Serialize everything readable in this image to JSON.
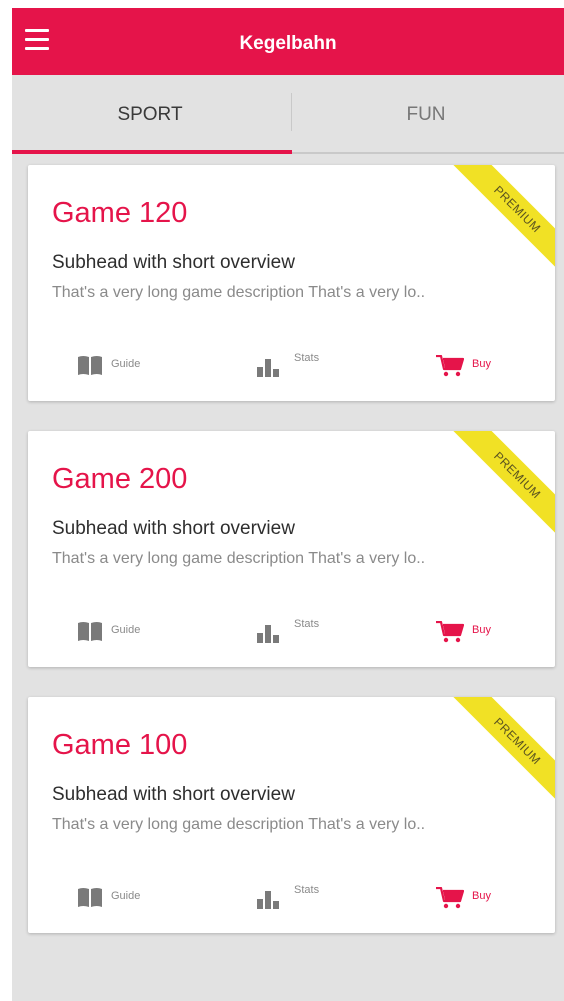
{
  "appbar": {
    "title": "Kegelbahn"
  },
  "tabs": [
    {
      "label": "SPORT",
      "active": true
    },
    {
      "label": "FUN",
      "active": false
    }
  ],
  "colors": {
    "accent": "#e5144a",
    "ribbon": "#f1e125",
    "background": "#e2e2e2"
  },
  "cards": [
    {
      "title": "Game 120",
      "subhead": "Subhead with short overview",
      "description": "That's a very long game description That's a very lo..",
      "ribbon": "PREMIUM",
      "actions": {
        "guide": "Guide",
        "stats": "Stats",
        "buy": "Buy"
      }
    },
    {
      "title": "Game 200",
      "subhead": "Subhead with short overview",
      "description": "That's a very long game description That's a very lo..",
      "ribbon": "PREMIUM",
      "actions": {
        "guide": "Guide",
        "stats": "Stats",
        "buy": "Buy"
      }
    },
    {
      "title": "Game 100",
      "subhead": "Subhead with short overview",
      "description": "That's a very long game description That's a very lo..",
      "ribbon": "PREMIUM",
      "actions": {
        "guide": "Guide",
        "stats": "Stats",
        "buy": "Buy"
      }
    }
  ],
  "icons": {
    "menu": "hamburger-menu-icon",
    "guide": "book-icon",
    "stats": "bar-chart-icon",
    "buy": "shopping-cart-icon"
  }
}
